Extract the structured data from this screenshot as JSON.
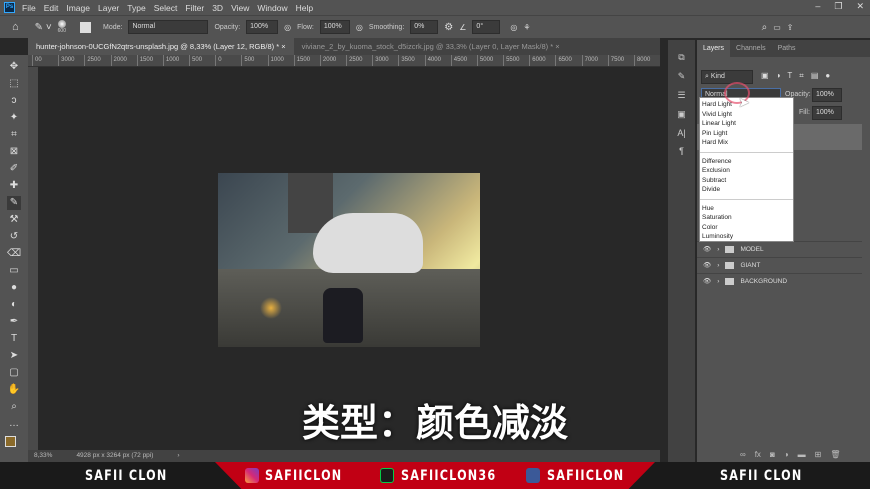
{
  "menubar": {
    "logo": "Ps",
    "items": [
      "File",
      "Edit",
      "Image",
      "Layer",
      "Type",
      "Select",
      "Filter",
      "3D",
      "View",
      "Window",
      "Help"
    ]
  },
  "options": {
    "brush_size": "600",
    "mode_label": "Mode:",
    "mode_value": "Normal",
    "opacity_label": "Opacity:",
    "opacity_value": "100%",
    "flow_label": "Flow:",
    "flow_value": "100%",
    "smoothing_label": "Smoothing:",
    "smoothing_value": "0%",
    "angle_value": "0°"
  },
  "tabs": [
    {
      "label": "hunter-johnson-0UCGfN2qtrs-unsplash.jpg @ 8,33% (Layer 12, RGB/8) *",
      "active": true
    },
    {
      "label": "viviane_2_by_kuoma_stock_d5izcrk.jpg @ 33,3% (Layer 0, Layer Mask/8) *",
      "active": false
    }
  ],
  "ruler": [
    "00",
    "3000",
    "2500",
    "2000",
    "1500",
    "1000",
    "500",
    "0",
    "500",
    "1000",
    "1500",
    "2000",
    "2500",
    "3000",
    "3500",
    "4000",
    "4500",
    "5000",
    "5500",
    "6000",
    "6500",
    "7000",
    "7500",
    "8000"
  ],
  "caption": "类型：颜色减淡",
  "status": {
    "zoom": "8,33%",
    "doc_size": "4928 px x 3264 px (72 ppi)"
  },
  "layers_panel": {
    "tabs": [
      "Layers",
      "Channels",
      "Paths"
    ],
    "filter": "Kind",
    "blend_mode": "Normal",
    "opacity_label": "Opacity:",
    "opacity_value": "100%",
    "fill_label": "Fill:",
    "fill_value": "100%",
    "blend_menu": [
      [
        "Hard Light",
        "Vivid Light",
        "Linear Light",
        "Pin Light",
        "Hard Mix"
      ],
      [
        "Difference",
        "Exclusion",
        "Subtract",
        "Divide"
      ],
      [
        "Hue",
        "Saturation",
        "Color",
        "Luminosity"
      ]
    ],
    "layers": [
      "MODEL",
      "GIANT",
      "BACKGROUND"
    ]
  },
  "banner": {
    "left": "SAFII CLON",
    "instagram": "SAFIICLON",
    "deviantart": "SAFIICLON36",
    "facebook": "SAFIICLON",
    "right": "SAFII CLON",
    "red": "#c10014"
  }
}
